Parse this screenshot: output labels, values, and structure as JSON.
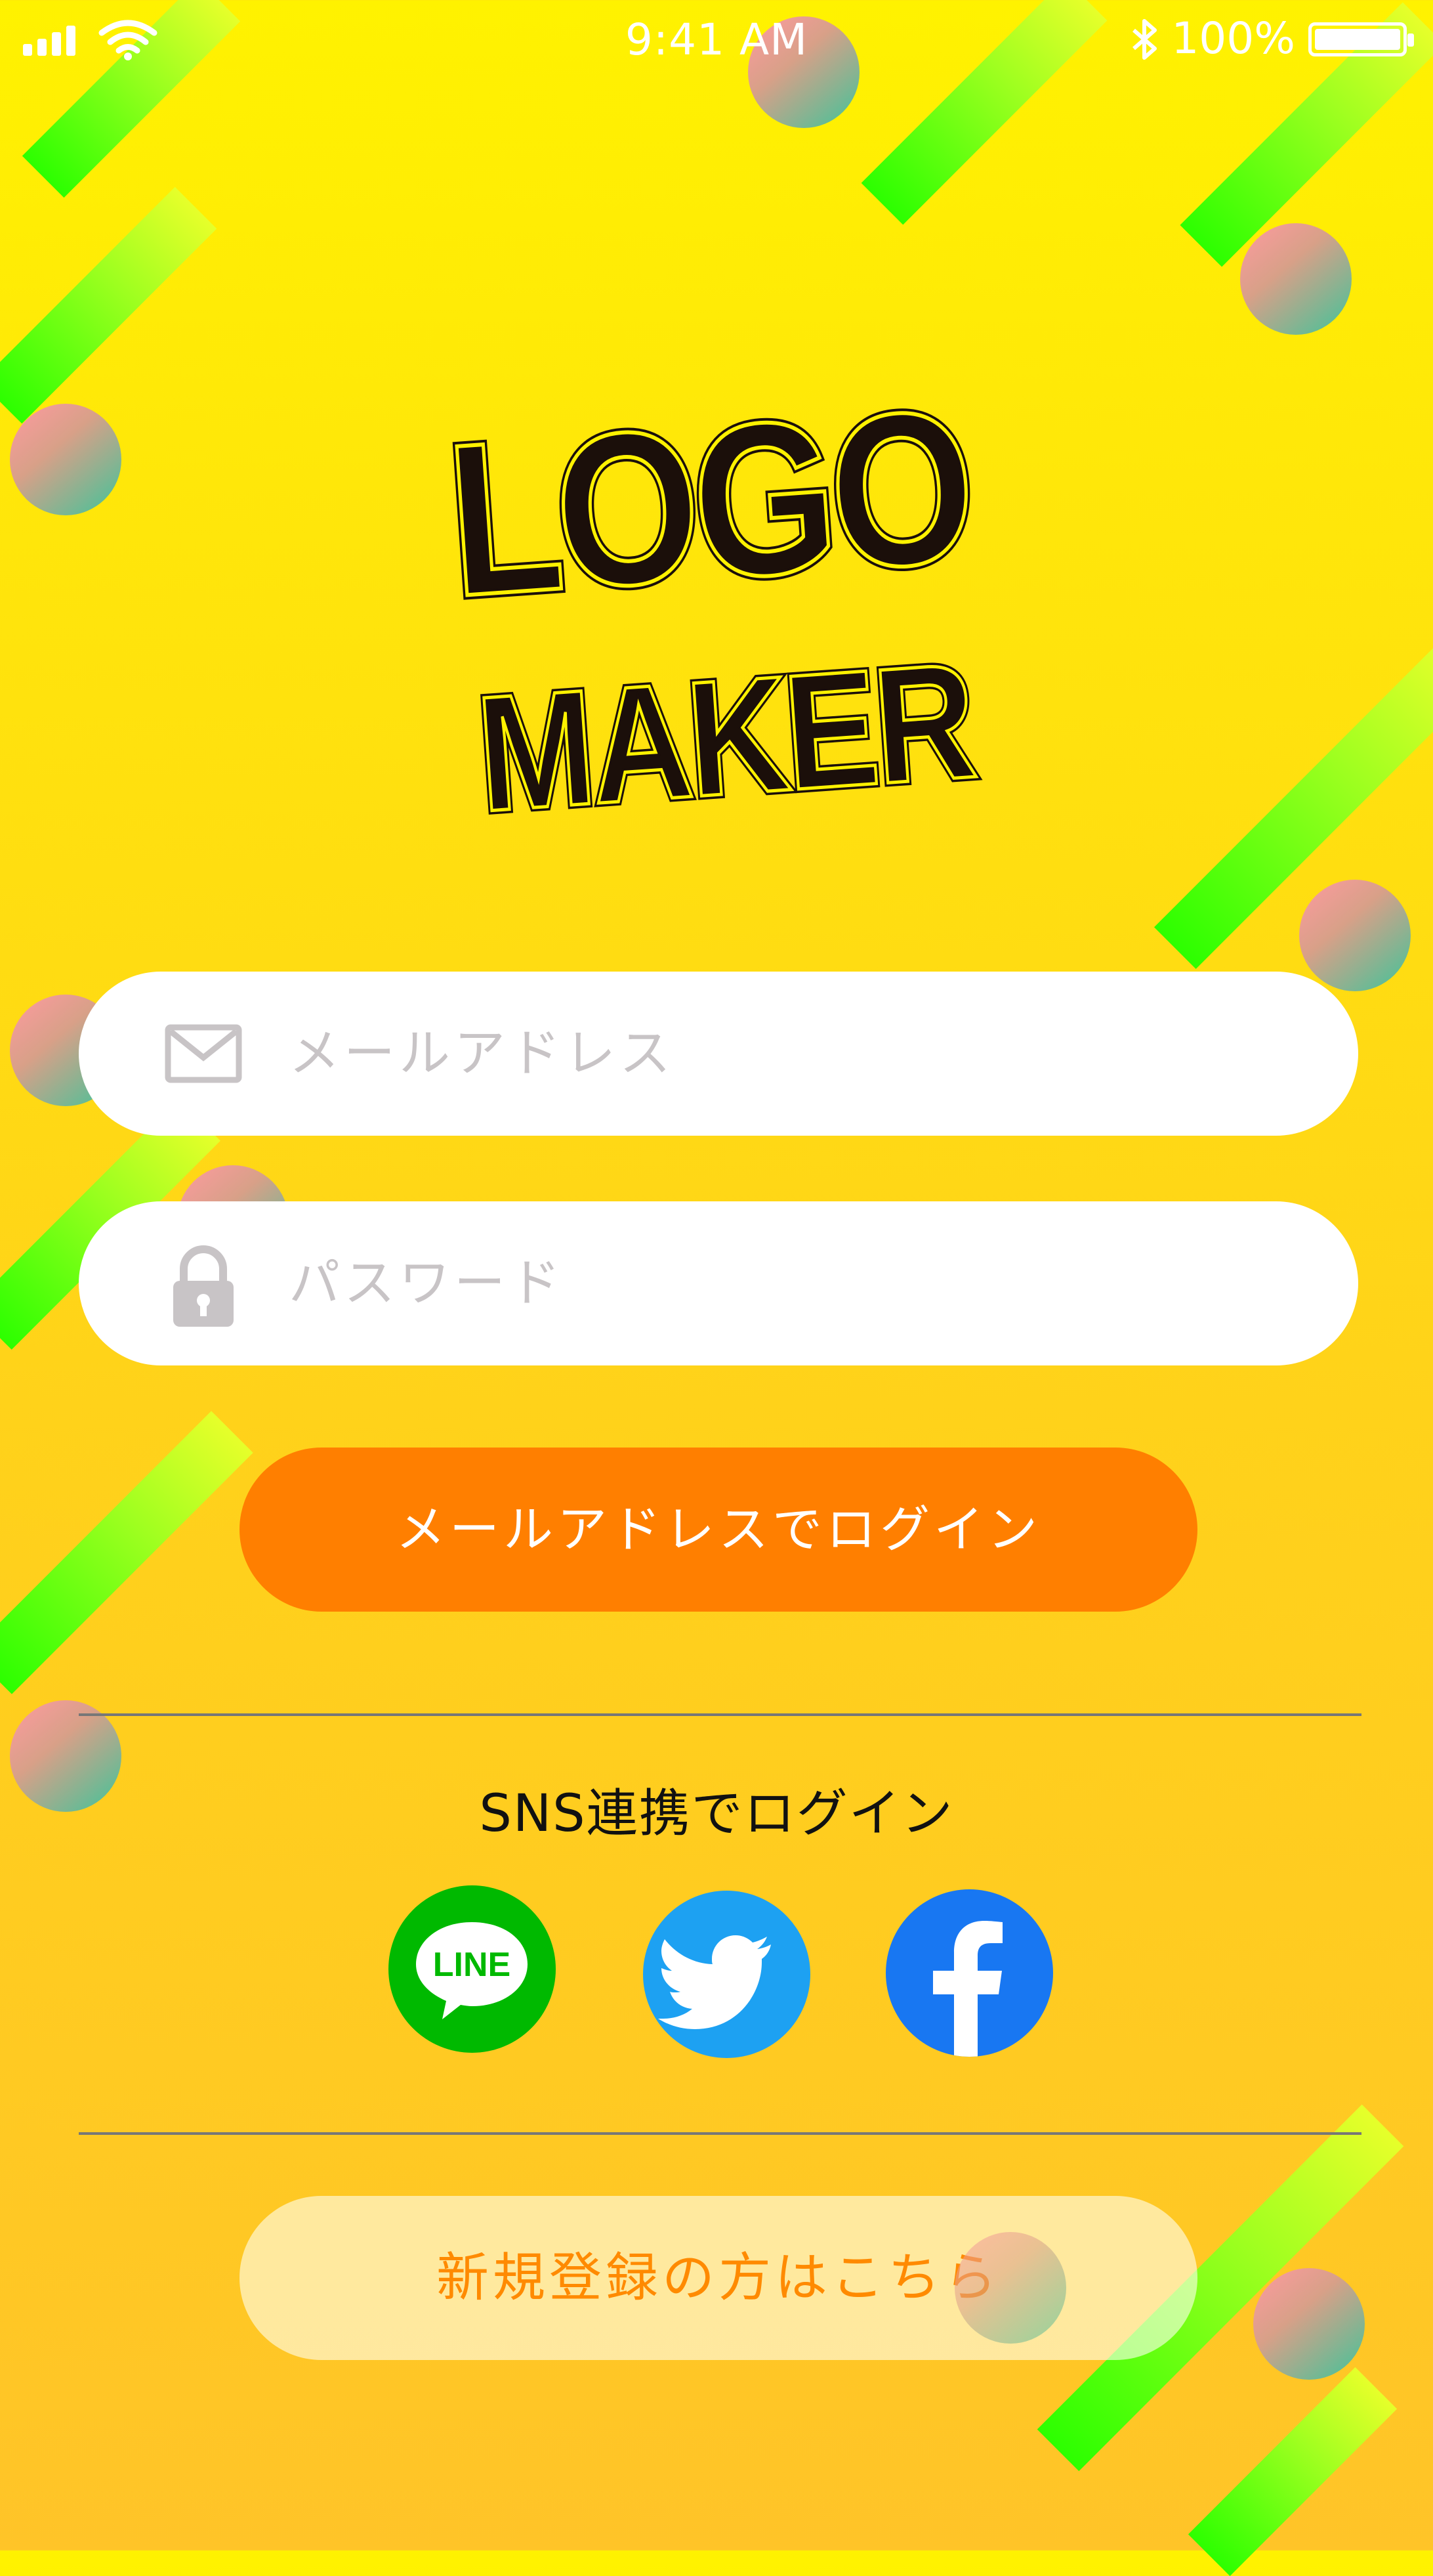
{
  "status_bar": {
    "time": "9:41 AM",
    "battery": "100%"
  },
  "logo": {
    "line1": "LOGO",
    "line2": "MAKER"
  },
  "email_field": {
    "placeholder": "メールアドレス"
  },
  "password_field": {
    "placeholder": "パスワード"
  },
  "login_button": {
    "label": "メールアドレスでログイン"
  },
  "sns": {
    "label": "SNS連携でログイン",
    "buttons": [
      {
        "name": "LINE",
        "color": "#00b900"
      },
      {
        "name": "twitter",
        "color": "#1da1f2"
      },
      {
        "name": "facebook",
        "color": "#1877f2"
      }
    ]
  },
  "register_button": {
    "label": "新規登録の方はこちら"
  },
  "colors": {
    "accent": "#ff7f00",
    "background_top": "#fff200",
    "background_bottom": "#ffc428"
  },
  "icons": [
    "signal-icon",
    "wifi-icon",
    "bluetooth-icon",
    "battery-icon",
    "mail-icon",
    "lock-icon",
    "line-icon",
    "twitter-icon",
    "facebook-icon"
  ]
}
